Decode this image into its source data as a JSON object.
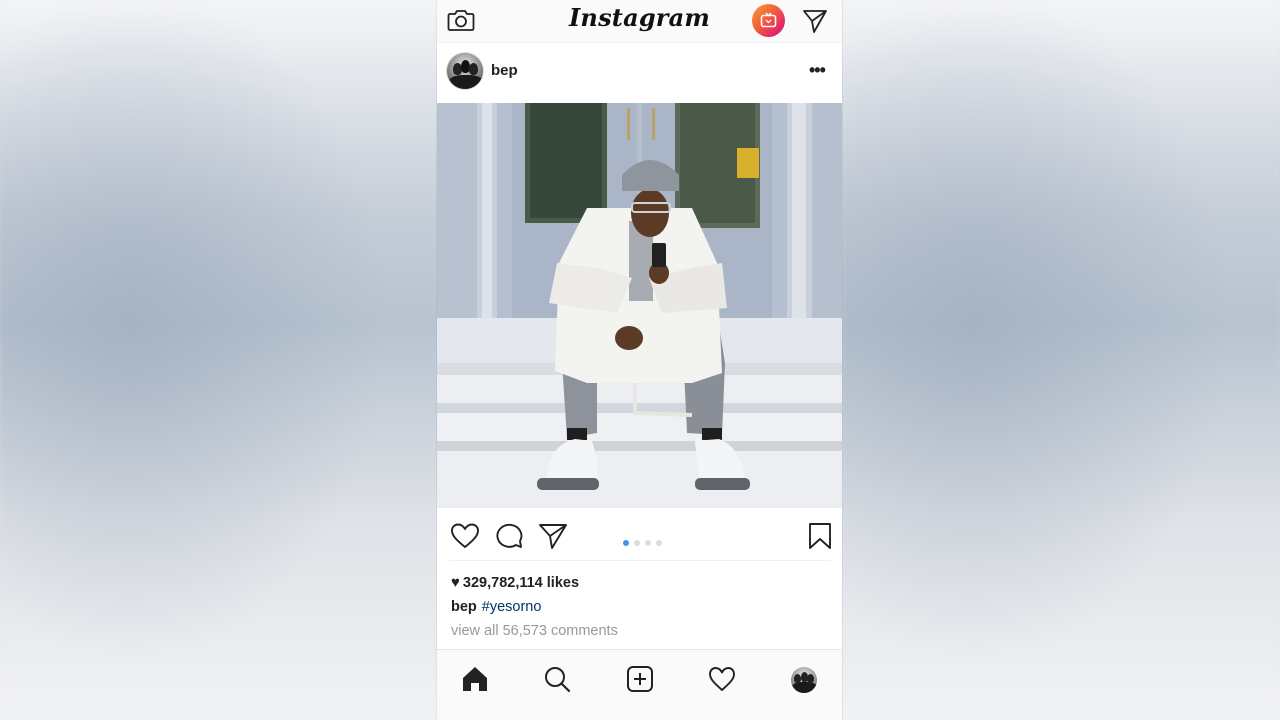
{
  "topbar": {
    "logo_text": "Instagram",
    "camera_icon": "camera-icon",
    "igtv_icon": "igtv-icon",
    "direct_icon": "direct-message-icon"
  },
  "post": {
    "username": "bep",
    "more_label": "•••",
    "likes_text": "329,782,114 likes",
    "caption_user": "bep",
    "caption_hashtag": "#yesorno",
    "view_comments": "view all 56,573 comments",
    "carousel": {
      "count": 4,
      "active": 1
    }
  },
  "actions": {
    "icons": [
      "heart-icon",
      "comment-icon",
      "share-icon",
      "bookmark-icon"
    ]
  },
  "bottom_nav": {
    "items": [
      "home-icon",
      "search-icon",
      "add-post-icon",
      "activity-heart-icon",
      "profile-avatar"
    ]
  },
  "colors": {
    "accent_blue": "#3897f0",
    "hashtag": "#003569",
    "muted": "#999999",
    "igtv_gradient": [
      "#f9a12b",
      "#e3246a"
    ]
  }
}
